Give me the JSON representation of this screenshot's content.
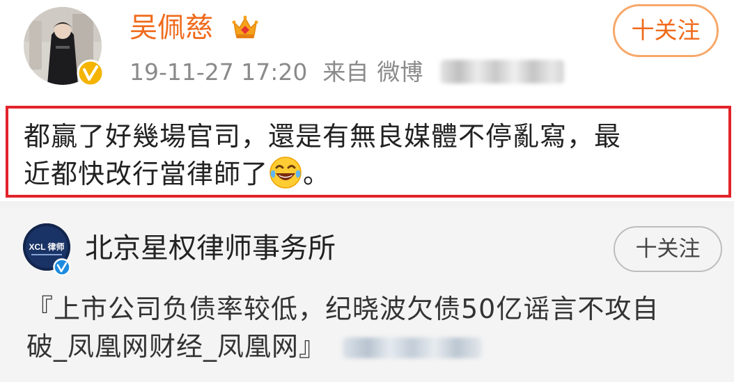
{
  "post": {
    "author": "吴佩慈",
    "time": "19-11-27 17:20",
    "source_label": "来自",
    "source_app": "微博",
    "follow_label": "十关注",
    "content_line1": "都贏了好幾場官司，還是有無良媒體不停亂寫，最",
    "content_line2_prefix": "近都快改行當律師了",
    "content_line2_suffix": "。",
    "emoji_icon": "laughing-tears-emoji-icon"
  },
  "repost": {
    "org_name": "北京星权律师事务所",
    "org_logo_text": "XCL 律师",
    "follow_label": "十关注",
    "article_line1": "『上市公司负债率较低，纪晓波欠债50亿谣言不攻自",
    "article_line2": "破_凤凰网财经_凤凰网』"
  },
  "colors": {
    "author_name": "#f06a1b",
    "highlight_border": "#e2232a",
    "follow_border": "#f7a86a",
    "verified_badge": "#f5b400",
    "org_verified_badge": "#1d8ce0"
  }
}
